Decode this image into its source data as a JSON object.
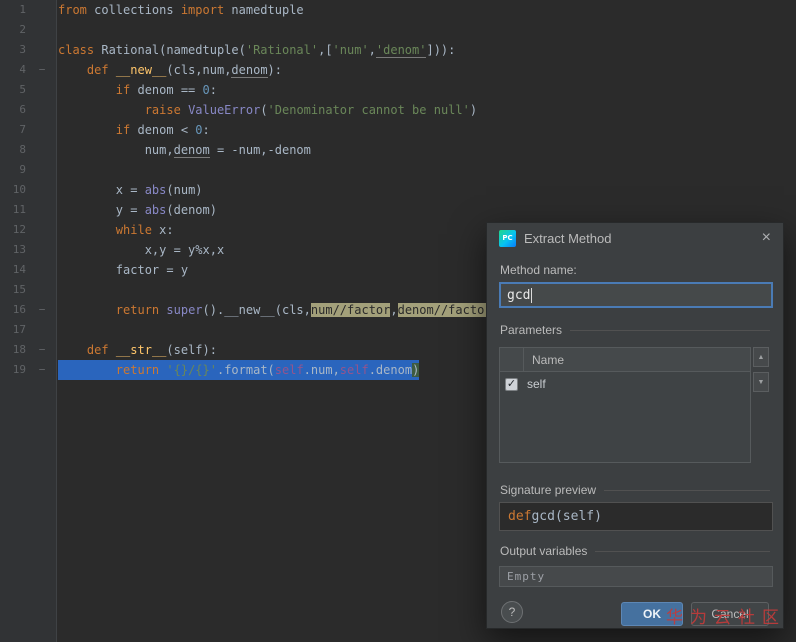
{
  "colors": {
    "editor_bg": "#2b2b2b",
    "gutter_bg": "#313335",
    "line_number": "#606366",
    "text": "#a9b7c6",
    "keyword": "#cc7832",
    "string": "#6a8759",
    "number": "#6897bb",
    "builtin": "#8888c6",
    "func": "#ffc66b",
    "self_kw": "#94558d",
    "selection": "#2a65bd",
    "fragment_bg": "#a3a07a",
    "fragment_text": "#2b2b2b",
    "dialog_bg": "#3c3f41",
    "accent": "#4a7bb5",
    "ok_bg": "#45719f",
    "label": "#bbbbbb",
    "watermark": "#c23b3b"
  },
  "watermark": "华为云社区",
  "editor": {
    "fold_glyph": "−",
    "lines": [
      {
        "num": 1,
        "segments": [
          {
            "t": "from",
            "c": "kw"
          },
          {
            "t": " collections ",
            "c": "txt"
          },
          {
            "t": "import",
            "c": "kw"
          },
          {
            "t": " namedtuple",
            "c": "txt"
          }
        ]
      },
      {
        "num": 2,
        "segments": []
      },
      {
        "num": 3,
        "segments": [
          {
            "t": "class",
            "c": "kw"
          },
          {
            "t": " Rational(namedtuple(",
            "c": "txt"
          },
          {
            "t": "'Rational'",
            "c": "str"
          },
          {
            "t": ",[",
            "c": "txt"
          },
          {
            "t": "'num'",
            "c": "str"
          },
          {
            "t": ",",
            "c": "txt"
          },
          {
            "t": "'denom'",
            "c": "str_u"
          },
          {
            "t": "])):",
            "c": "txt"
          }
        ]
      },
      {
        "num": 4,
        "fold": true,
        "segments": [
          {
            "t": "    ",
            "c": "txt"
          },
          {
            "t": "def",
            "c": "kw"
          },
          {
            "t": " __new__",
            "c": "fn"
          },
          {
            "t": "(cls,num,",
            "c": "txt"
          },
          {
            "t": "denom",
            "c": "txt_u"
          },
          {
            "t": "):",
            "c": "txt"
          }
        ]
      },
      {
        "num": 5,
        "segments": [
          {
            "t": "        ",
            "c": "txt"
          },
          {
            "t": "if",
            "c": "kw"
          },
          {
            "t": " denom == ",
            "c": "txt"
          },
          {
            "t": "0",
            "c": "num"
          },
          {
            "t": ":",
            "c": "txt"
          }
        ]
      },
      {
        "num": 6,
        "segments": [
          {
            "t": "            ",
            "c": "txt"
          },
          {
            "t": "raise",
            "c": "kw"
          },
          {
            "t": " ",
            "c": "txt"
          },
          {
            "t": "ValueError",
            "c": "bi"
          },
          {
            "t": "(",
            "c": "txt"
          },
          {
            "t": "'Denominator cannot be null'",
            "c": "str"
          },
          {
            "t": ")",
            "c": "txt"
          }
        ]
      },
      {
        "num": 7,
        "segments": [
          {
            "t": "        ",
            "c": "txt"
          },
          {
            "t": "if",
            "c": "kw"
          },
          {
            "t": " denom < ",
            "c": "txt"
          },
          {
            "t": "0",
            "c": "num"
          },
          {
            "t": ":",
            "c": "txt"
          }
        ]
      },
      {
        "num": 8,
        "segments": [
          {
            "t": "            num,",
            "c": "txt"
          },
          {
            "t": "denom",
            "c": "txt_u"
          },
          {
            "t": " = -num,-denom",
            "c": "txt"
          }
        ]
      },
      {
        "num": 9,
        "segments": []
      },
      {
        "num": 10,
        "segments": [
          {
            "t": "        x = ",
            "c": "txt"
          },
          {
            "t": "abs",
            "c": "bi"
          },
          {
            "t": "(num)",
            "c": "txt"
          }
        ]
      },
      {
        "num": 11,
        "segments": [
          {
            "t": "        y = ",
            "c": "txt"
          },
          {
            "t": "abs",
            "c": "bi"
          },
          {
            "t": "(denom)",
            "c": "txt"
          }
        ]
      },
      {
        "num": 12,
        "segments": [
          {
            "t": "        ",
            "c": "txt"
          },
          {
            "t": "while",
            "c": "kw"
          },
          {
            "t": " x:",
            "c": "txt"
          }
        ]
      },
      {
        "num": 13,
        "segments": [
          {
            "t": "            x,y = y%x,x",
            "c": "txt"
          }
        ]
      },
      {
        "num": 14,
        "segments": [
          {
            "t": "        factor = y",
            "c": "txt"
          }
        ]
      },
      {
        "num": 15,
        "segments": []
      },
      {
        "num": 16,
        "fold": true,
        "segments": [
          {
            "t": "        ",
            "c": "txt"
          },
          {
            "t": "return",
            "c": "kw"
          },
          {
            "t": " ",
            "c": "txt"
          },
          {
            "t": "super",
            "c": "bi"
          },
          {
            "t": "().__new__(cls,",
            "c": "txt"
          },
          {
            "t": "num//factor",
            "c": "frag"
          },
          {
            "t": ",",
            "c": "txt"
          },
          {
            "t": "denom//factor",
            "c": "frag"
          },
          {
            "t": ")",
            "c": "txt"
          }
        ]
      },
      {
        "num": 17,
        "segments": []
      },
      {
        "num": 18,
        "fold": true,
        "segments": [
          {
            "t": "    ",
            "c": "txt"
          },
          {
            "t": "def",
            "c": "kw"
          },
          {
            "t": " __str__",
            "c": "fn"
          },
          {
            "t": "(self):",
            "c": "txt"
          }
        ]
      },
      {
        "num": 19,
        "fold": true,
        "sel": true,
        "segments": [
          {
            "t": "        ",
            "c": "txt"
          },
          {
            "t": "return",
            "c": "kw"
          },
          {
            "t": " ",
            "c": "txt"
          },
          {
            "t": "'{}/{}'",
            "c": "str"
          },
          {
            "t": ".format(",
            "c": "txt"
          },
          {
            "t": "self",
            "c": "self"
          },
          {
            "t": ".num,",
            "c": "txt"
          },
          {
            "t": "self",
            "c": "self"
          },
          {
            "t": ".denom",
            "c": "txt"
          },
          {
            "t": ")",
            "c": "paren"
          }
        ]
      }
    ]
  },
  "dialog": {
    "icon_label": "PC",
    "title": "Extract Method",
    "close_glyph": "×",
    "method_name_label": "Method name:",
    "method_name_value": "gcd",
    "parameters_label": "Parameters",
    "table": {
      "header": "Name",
      "check_glyph": "✓",
      "up_glyph": "▲",
      "down_glyph": "▼",
      "rows": [
        {
          "checked": true,
          "name": "self"
        }
      ]
    },
    "signature_label": "Signature preview",
    "signature": {
      "kw": "def ",
      "rest": "gcd(self)"
    },
    "output_label": "Output variables",
    "output_value": "Empty",
    "help_label": "?",
    "ok_label": "OK",
    "cancel_label": "Cancel"
  }
}
